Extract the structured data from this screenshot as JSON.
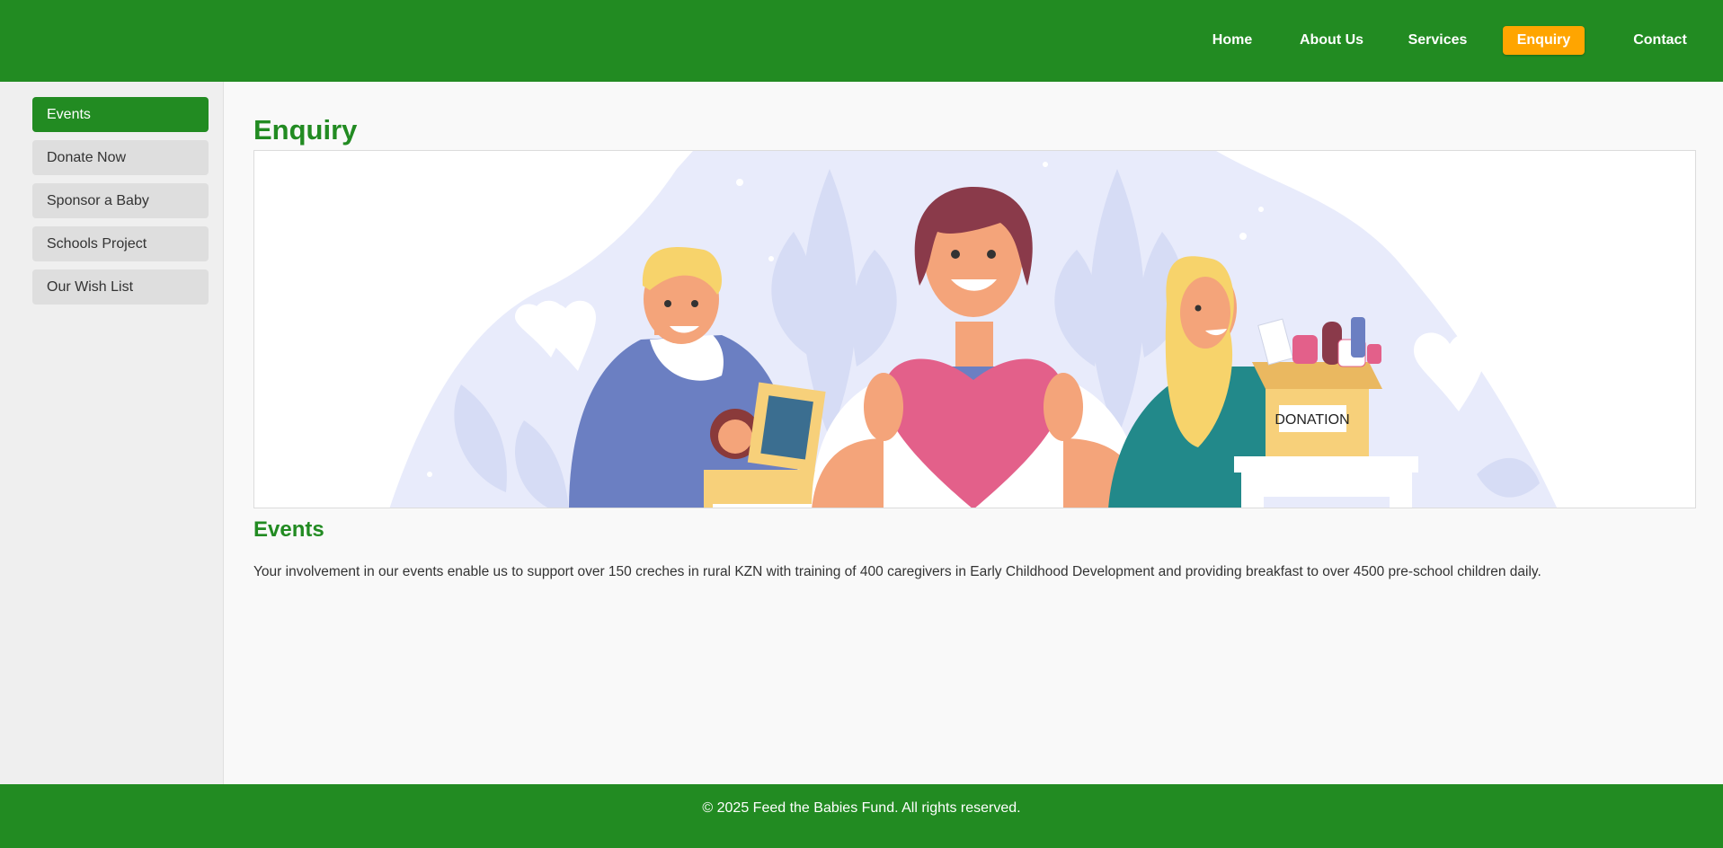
{
  "nav": {
    "items": [
      {
        "label": "Home"
      },
      {
        "label": "About Us"
      },
      {
        "label": "Services"
      },
      {
        "label": "Enquiry",
        "active": true
      },
      {
        "label": "Contact"
      }
    ]
  },
  "sidebar": {
    "items": [
      {
        "label": "Events",
        "active": true
      },
      {
        "label": "Donate Now"
      },
      {
        "label": "Sponsor a Baby"
      },
      {
        "label": "Schools Project"
      },
      {
        "label": "Our Wish List"
      }
    ]
  },
  "main": {
    "title": "Enquiry",
    "banner": {
      "box_label": "DONATION",
      "box_label_partial": "DONATION"
    },
    "section": {
      "title": "Events",
      "text": "Your involvement in our events enable us to support over 150 creches in rural KZN with training of 400 caregivers in Early Childhood Development and providing breakfast to over 4500 pre-school children daily."
    }
  },
  "footer": {
    "text": "© 2025 Feed the Babies Fund. All rights reserved."
  },
  "colors": {
    "brand_green": "#228b22",
    "accent_orange": "#ffa500",
    "sidebar_bg": "#efefef",
    "sidebar_item_bg": "#dedede",
    "heart_pink": "#e3608a"
  }
}
